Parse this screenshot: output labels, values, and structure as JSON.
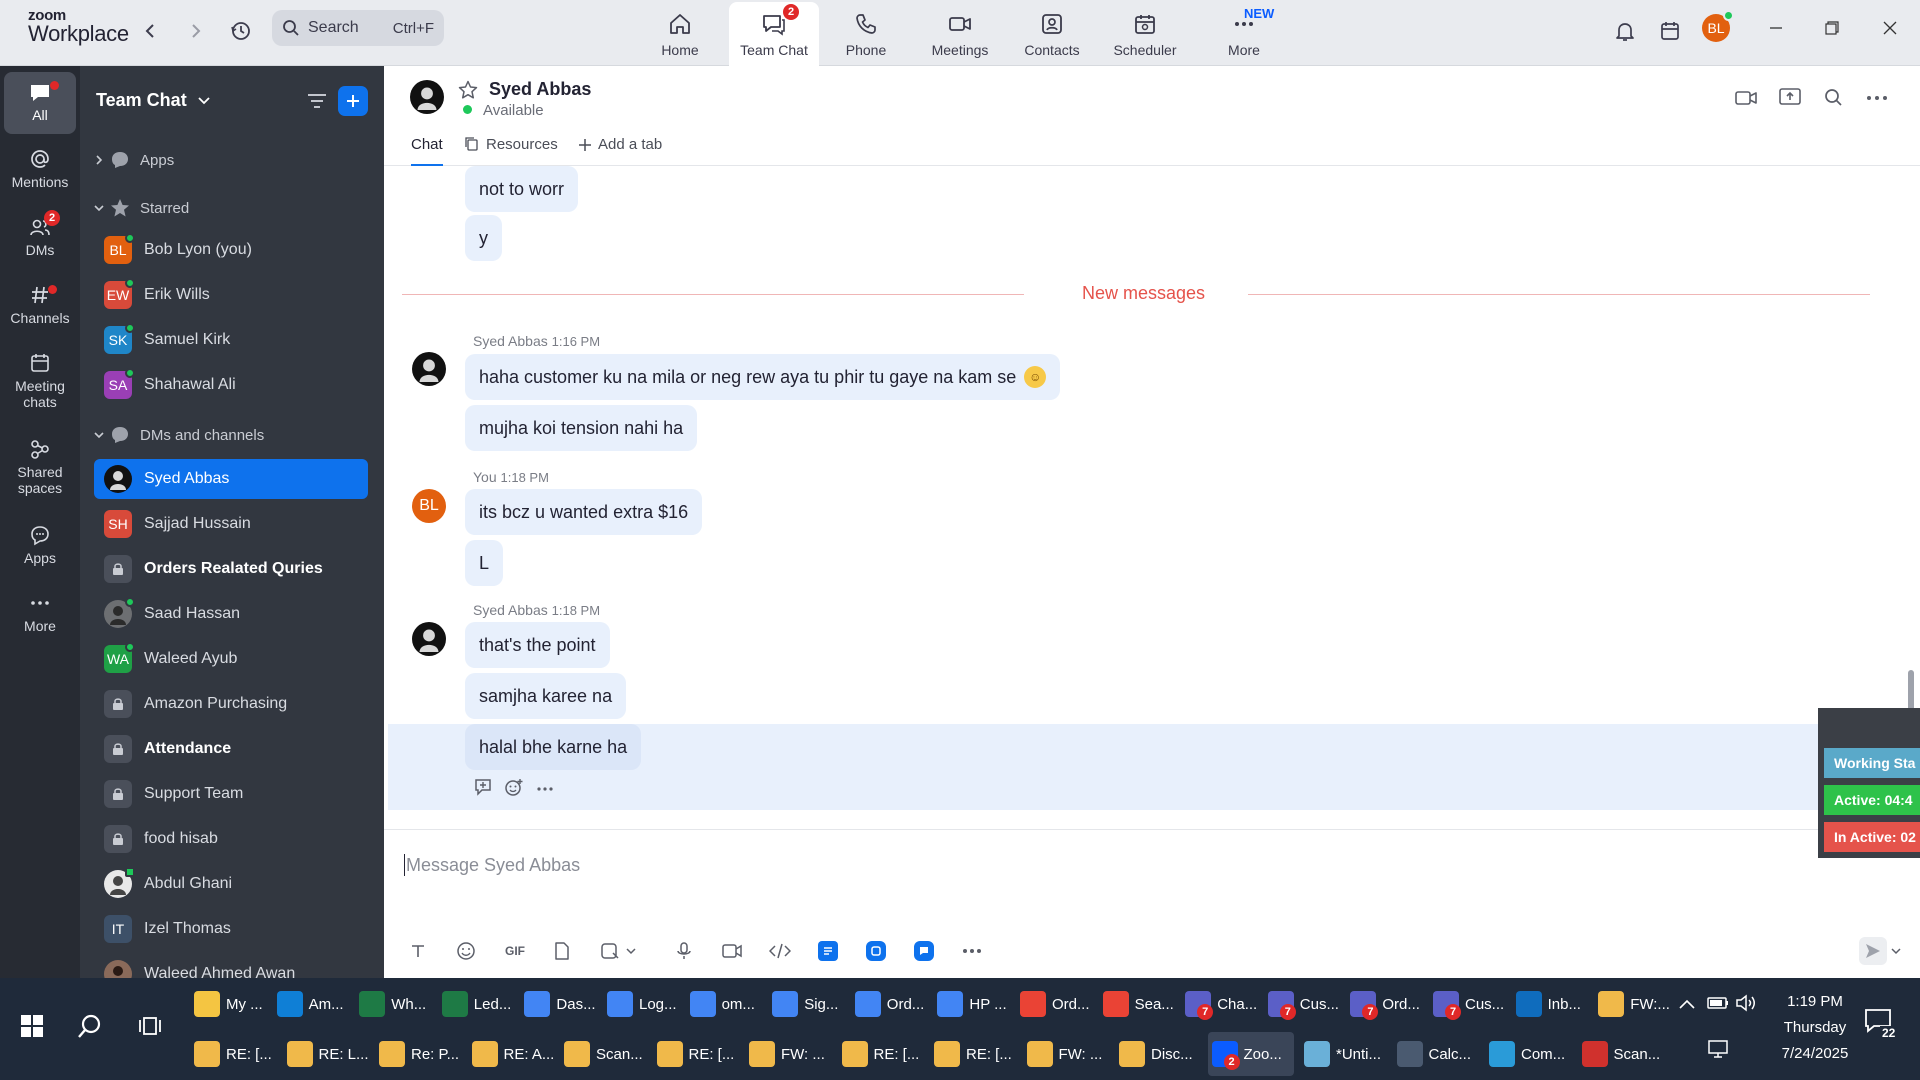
{
  "app": {
    "logo_top": "zoom",
    "logo_bottom": "Workplace"
  },
  "search": {
    "placeholder": "Search",
    "shortcut": "Ctrl+F"
  },
  "nav_tabs": [
    {
      "label": "Home",
      "icon": "home-icon"
    },
    {
      "label": "Team Chat",
      "icon": "chat-icon",
      "badge": "2",
      "active": true
    },
    {
      "label": "Phone",
      "icon": "phone-icon"
    },
    {
      "label": "Meetings",
      "icon": "video-icon"
    },
    {
      "label": "Contacts",
      "icon": "contacts-icon"
    },
    {
      "label": "Scheduler",
      "icon": "calendar-icon"
    },
    {
      "label": "More",
      "icon": "more-icon",
      "badge": "NEW"
    }
  ],
  "user": {
    "initials": "BL",
    "color": "#e2600f"
  },
  "rail": [
    {
      "label": "All",
      "active": true
    },
    {
      "label": "Mentions"
    },
    {
      "label": "DMs",
      "badge": "2"
    },
    {
      "label": "Channels"
    },
    {
      "label": "Meeting chats"
    },
    {
      "label": "Shared spaces"
    },
    {
      "label": "Apps"
    },
    {
      "label": "More"
    }
  ],
  "sidebar": {
    "title": "Team Chat",
    "sections": {
      "apps": "Apps",
      "starred": "Starred",
      "dms": "DMs and channels"
    },
    "starred": [
      {
        "name": "Bob Lyon (you)",
        "initials": "BL",
        "color": "#e2600f"
      },
      {
        "name": "Erik Wills",
        "initials": "EW",
        "color": "#d84a3a"
      },
      {
        "name": "Samuel Kirk",
        "initials": "SK",
        "color": "#1f86c8"
      },
      {
        "name": "Shahawal Ali",
        "initials": "SA",
        "color": "#9a3fb5"
      }
    ],
    "dms": [
      {
        "name": "Syed Abbas",
        "type": "photo",
        "selected": true
      },
      {
        "name": "Sajjad Hussain",
        "initials": "SH",
        "color": "#d84a3a"
      },
      {
        "name": "Orders Realated Quries",
        "type": "lock",
        "bold": true
      },
      {
        "name": "Saad Hassan",
        "type": "photo"
      },
      {
        "name": "Waleed Ayub",
        "initials": "WA",
        "color": "#1fa046"
      },
      {
        "name": "Amazon Purchasing",
        "type": "lock"
      },
      {
        "name": "Attendance",
        "type": "lock",
        "bold": true
      },
      {
        "name": "Support Team",
        "type": "lock"
      },
      {
        "name": "food hisab",
        "type": "lock"
      },
      {
        "name": "Abdul Ghani",
        "type": "photo"
      },
      {
        "name": "Izel Thomas",
        "initials": "IT",
        "color": "#3d5068"
      },
      {
        "name": "Waleed Ahmed Awan",
        "type": "photo"
      }
    ]
  },
  "chat": {
    "contact": "Syed Abbas",
    "status": "Available",
    "tabs": [
      "Chat",
      "Resources",
      "Add a tab"
    ],
    "new_messages_label": "New messages",
    "earlier": [
      "not to worr",
      "y"
    ],
    "groups": [
      {
        "sender": "Syed Abbas",
        "time": "1:16 PM",
        "messages": [
          "haha customer ku na mila or neg rew aya tu phir tu gaye na kam se",
          "mujha koi tension nahi ha"
        ]
      },
      {
        "sender": "You",
        "time": "1:18 PM",
        "messages": [
          "its bcz u wanted extra $16",
          "L"
        ]
      },
      {
        "sender": "Syed Abbas",
        "time": "1:18 PM",
        "messages": [
          "that's the point",
          "samjha karee na",
          "halal bhe karne ha"
        ]
      }
    ],
    "composer_placeholder": "Message Syed Abbas",
    "gif_label": "GIF"
  },
  "widget": {
    "line1": "Working Sta",
    "line2": "Active: 04:4",
    "line3": "In Active: 02",
    "colors": {
      "line1": "#5aa9c9",
      "line2": "#2ec24a",
      "line3": "#e5534b"
    }
  },
  "taskbar": {
    "row1": [
      {
        "label": "My ...",
        "color": "#f4c542"
      },
      {
        "label": "Am...",
        "color": "#0f7fd6"
      },
      {
        "label": "Wh...",
        "color": "#1e7a45"
      },
      {
        "label": "Led...",
        "color": "#1e7a45"
      },
      {
        "label": "Das...",
        "color": "#4285f4"
      },
      {
        "label": "Log...",
        "color": "#4285f4"
      },
      {
        "label": "om...",
        "color": "#4285f4"
      },
      {
        "label": "Sig...",
        "color": "#4285f4"
      },
      {
        "label": "Ord...",
        "color": "#4285f4"
      },
      {
        "label": "HP ...",
        "color": "#4285f4"
      },
      {
        "label": "Ord...",
        "color": "#ea4335"
      },
      {
        "label": "Sea...",
        "color": "#ea4335"
      },
      {
        "label": "Cha...",
        "color": "#5b5fc7"
      },
      {
        "label": "Cus...",
        "color": "#5b5fc7"
      },
      {
        "label": "Ord...",
        "color": "#5b5fc7"
      },
      {
        "label": "Cus...",
        "color": "#5b5fc7"
      },
      {
        "label": "Inb...",
        "color": "#0f6cbd"
      },
      {
        "label": "FW:...",
        "color": "#f0b94a"
      }
    ],
    "row2": [
      {
        "label": "RE: [...",
        "color": "#f0b94a"
      },
      {
        "label": "RE: L...",
        "color": "#f0b94a"
      },
      {
        "label": "Re: P...",
        "color": "#f0b94a"
      },
      {
        "label": "RE: A...",
        "color": "#f0b94a"
      },
      {
        "label": "Scan...",
        "color": "#f0b94a"
      },
      {
        "label": "RE: [...",
        "color": "#f0b94a"
      },
      {
        "label": "FW: ...",
        "color": "#f0b94a"
      },
      {
        "label": "RE: [...",
        "color": "#f0b94a"
      },
      {
        "label": "RE: [...",
        "color": "#f0b94a"
      },
      {
        "label": "FW: ...",
        "color": "#f0b94a"
      },
      {
        "label": "Disc...",
        "color": "#f0b94a"
      },
      {
        "label": "Zoo...",
        "color": "#0b5cff",
        "active": true
      },
      {
        "label": "*Unti...",
        "color": "#6ab0d8"
      },
      {
        "label": "Calc...",
        "color": "#4a5a70"
      },
      {
        "label": "Com...",
        "color": "#2a9bd8"
      },
      {
        "label": "Scan...",
        "color": "#d0312d"
      }
    ],
    "teams_badge": "7",
    "zoom_badge": "2",
    "clock": {
      "time": "1:19 PM",
      "day": "Thursday",
      "date": "7/24/2025"
    },
    "notif_count": "22"
  }
}
